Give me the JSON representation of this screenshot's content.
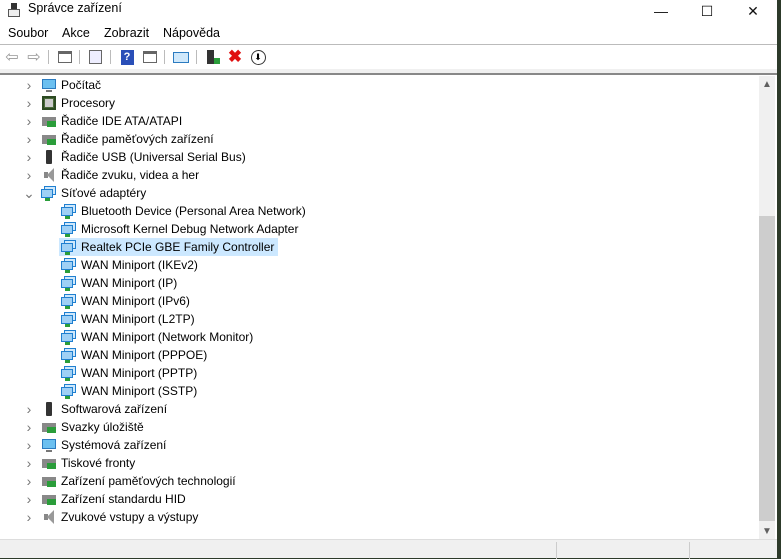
{
  "window": {
    "title": "Správce zařízení",
    "minimize": "—",
    "maximize": "☐",
    "close": "✕"
  },
  "menu": [
    "Soubor",
    "Akce",
    "Zobrazit",
    "Nápověda"
  ],
  "toolbar": [
    "back",
    "forward",
    "show-hide-console-tree",
    "properties",
    "help",
    "action-pane",
    "scan-hardware",
    "update-driver",
    "uninstall-device",
    "disable-device"
  ],
  "tree": {
    "before": [
      {
        "label": "Počítač",
        "icon": "monitor"
      },
      {
        "label": "Procesory",
        "icon": "cpu"
      },
      {
        "label": "Řadiče IDE ATA/ATAPI",
        "icon": "controller"
      },
      {
        "label": "Řadiče paměťových zařízení",
        "icon": "storage-controller"
      },
      {
        "label": "Řadiče USB (Universal Serial Bus)",
        "icon": "usb"
      },
      {
        "label": "Řadiče zvuku, videa a her",
        "icon": "speaker"
      }
    ],
    "expanded": {
      "label": "Síťové adaptéry",
      "icon": "network",
      "children": [
        "Bluetooth Device (Personal Area Network)",
        "Microsoft Kernel Debug Network Adapter",
        "Realtek PCIe GBE Family Controller",
        "WAN Miniport (IKEv2)",
        "WAN Miniport (IP)",
        "WAN Miniport (IPv6)",
        "WAN Miniport (L2TP)",
        "WAN Miniport (Network Monitor)",
        "WAN Miniport (PPPOE)",
        "WAN Miniport (PPTP)",
        "WAN Miniport (SSTP)"
      ],
      "selected_index": 2
    },
    "after": [
      {
        "label": "Softwarová zařízení",
        "icon": "usb"
      },
      {
        "label": "Svazky úložiště",
        "icon": "controller"
      },
      {
        "label": "Systémová zařízení",
        "icon": "monitor"
      },
      {
        "label": "Tiskové fronty",
        "icon": "controller"
      },
      {
        "label": "Zařízení paměťových technologií",
        "icon": "controller"
      },
      {
        "label": "Zařízení standardu HID",
        "icon": "controller"
      },
      {
        "label": "Zvukové vstupy a výstupy",
        "icon": "speaker"
      }
    ]
  },
  "colors": {
    "selection": "#cce8ff",
    "accent": "#1f7fd0"
  }
}
